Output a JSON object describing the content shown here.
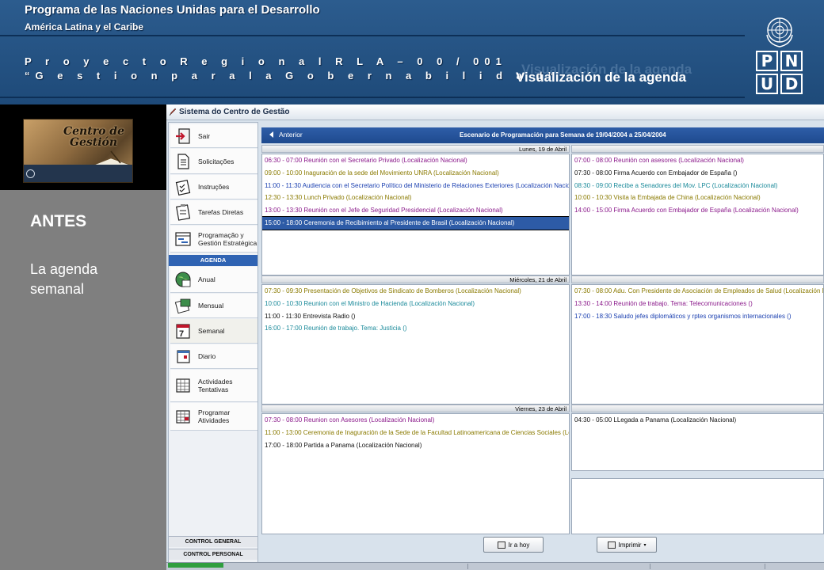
{
  "header": {
    "title": "Programa de las  Naciones Unidas para el  Desarrollo",
    "subtitle": "América Latina y el Caribe",
    "project_line1": "P r o y e c t o   R e g i o n a l  R L A – 0 0 / 001",
    "project_line2": "“G e s t i o n  p a r a  l a  G o b e r n a b i l i d a d”",
    "section_title": "Visualización de la agenda"
  },
  "logo": {
    "letters": [
      "P",
      "N",
      "U",
      "D"
    ]
  },
  "left_panel": {
    "image_text_line1": "Centro de",
    "image_text_line2": "Gestión",
    "heading": "ANTES",
    "description": "La agenda semanal"
  },
  "app": {
    "title": "Sistema do Centro de Gestão",
    "sidebar": {
      "items": [
        {
          "label": "Sair",
          "icon": "exit-door-icon"
        },
        {
          "label": "Solicitações",
          "icon": "document-icon"
        },
        {
          "label": "Instruções",
          "icon": "clipboard-checklist-icon"
        },
        {
          "label": "Tarefas Diretas",
          "icon": "clipboard-task-icon"
        },
        {
          "label": "Programação y Gestión Estratégica",
          "icon": "chart-icon"
        }
      ],
      "agenda_heading": "AGENDA",
      "agenda_items": [
        {
          "label": "Anual",
          "icon": "globe-calendar-icon"
        },
        {
          "label": "Mensual",
          "icon": "monthly-calendar-icon"
        },
        {
          "label": "Semanal",
          "icon": "weekly-calendar-icon",
          "active": true
        },
        {
          "label": "Diario",
          "icon": "daily-calendar-icon"
        },
        {
          "label": "Actividades Tentativas",
          "icon": "grid-calendar-icon"
        },
        {
          "label": "Programar Atividades",
          "icon": "schedule-icon"
        }
      ],
      "control_general": "CONTROL GENERAL",
      "control_personal": "CONTROL PERSONAL"
    },
    "nav": {
      "prev_label": "Anterior",
      "title": "Escenario de Programación para Semana de 19/04/2004 a 25/04/2004"
    },
    "days": {
      "monday": {
        "label": "Lunes, 19 de Abril",
        "events": [
          {
            "time": "06:30 - 07:00",
            "text": "Reunión con el Secretario Privado (Localización Nacional)",
            "color": "#8b1a8b"
          },
          {
            "time": "09:00 - 10:00",
            "text": "Inaguración de la sede del  Movimiento UNRA (Localización Nacional)",
            "color": "#8a7a00"
          },
          {
            "time": "11:00 - 11:30",
            "text": "Audiencia con el Secretario Político del Ministerio de Relaciones Exteriores (Localización Nacional)",
            "color": "#1a3fb0"
          },
          {
            "time": "12:30 - 13:30",
            "text": "Lunch Privado (Localización Nacional)",
            "color": "#8a7a00"
          },
          {
            "time": "13:00 - 13:30",
            "text": "Reunión con el Jefe de Seguridad Presidencial (Localización Nacional)",
            "color": "#8b1a8b"
          },
          {
            "time": "15:00 - 18:00",
            "text": "Ceremonia de Recibimiento al Presidente de Brasil (Localización Nacional)",
            "color": "#8b1a8b",
            "selected": true
          }
        ]
      },
      "tuesday": {
        "events": [
          {
            "time": "07:00 - 08:00",
            "text": "Reunión con asesores (Localización Nacional)",
            "color": "#8b1a8b"
          },
          {
            "time": "07:30 - 08:00",
            "text": "Firma Acuerdo con Embajador de España ()",
            "color": "#111111"
          },
          {
            "time": "08:30 - 09:00",
            "text": "Recibe a Senadores del Mov. LPC (Localización Nacional)",
            "color": "#1a8a9a"
          },
          {
            "time": "10:00 - 10:30",
            "text": "Visita la Embajada de China (Localización Nacional)",
            "color": "#8a7a00"
          },
          {
            "time": "14:00 - 15:00",
            "text": "Firma Acuerdo con Embajador de España (Localización Nacional)",
            "color": "#8b1a8b"
          }
        ]
      },
      "wednesday": {
        "label": "Miércoles, 21 de Abril",
        "events": [
          {
            "time": "07:30 - 09:30",
            "text": "Presentación de Objetivos de Sindicato de Bomberos (Localización Nacional)",
            "color": "#8a7a00"
          },
          {
            "time": "10:00 - 10:30",
            "text": "Reunion con el Ministro de Hacienda (Localización Nacional)",
            "color": "#1a8a9a"
          },
          {
            "time": "11:00 - 11:30",
            "text": "Entrevista Radio ()",
            "color": "#111111"
          },
          {
            "time": "16:00 - 17:00",
            "text": "Reunión de trabajo. Tema: Justicia ()",
            "color": "#1a8a9a"
          }
        ]
      },
      "thursday": {
        "events": [
          {
            "time": "07:30 - 08:00",
            "text": "Adu. Con Presidente de Asociación de Empleados de Salud (Localización Nacional)",
            "color": "#8a7a00"
          },
          {
            "time": "13:30 - 14:00",
            "text": "Reunión de trabajo. Tema: Telecomunicaciones ()",
            "color": "#8b1a8b"
          },
          {
            "time": "17:00 - 18:30",
            "text": "Saludo jefes diplomáticos y rptes organismos internacionales ()",
            "color": "#1a3fb0"
          }
        ]
      },
      "friday": {
        "label": "Viernes, 23 de Abril",
        "events": [
          {
            "time": "07:30 - 08:00",
            "text": "Reunion con Asesores (Localización Nacional)",
            "color": "#8b1a8b"
          },
          {
            "time": "11:00 - 13:00",
            "text": "Ceremonia de Inaguración de la Sede de la Facultad Latinoamericana de Ciencias Sociales (Localiz...",
            "color": "#8a7a00"
          },
          {
            "time": "17:00 - 18:00",
            "text": "Partida a Panama (Localización Nacional)",
            "color": "#111111"
          }
        ]
      },
      "saturday": {
        "events": [
          {
            "time": "04:30 - 05:00",
            "text": "LLegada a Panama (Localización Nacional)",
            "color": "#111111"
          }
        ]
      }
    },
    "buttons": {
      "today": "Ir a hoy",
      "print": "Imprimir"
    }
  },
  "colors": {
    "header_blue": "#2c5c8e",
    "nav_blue": "#2e5ea8",
    "selected_row": "#2d5ba6",
    "background_gray": "#7f7f7f"
  }
}
